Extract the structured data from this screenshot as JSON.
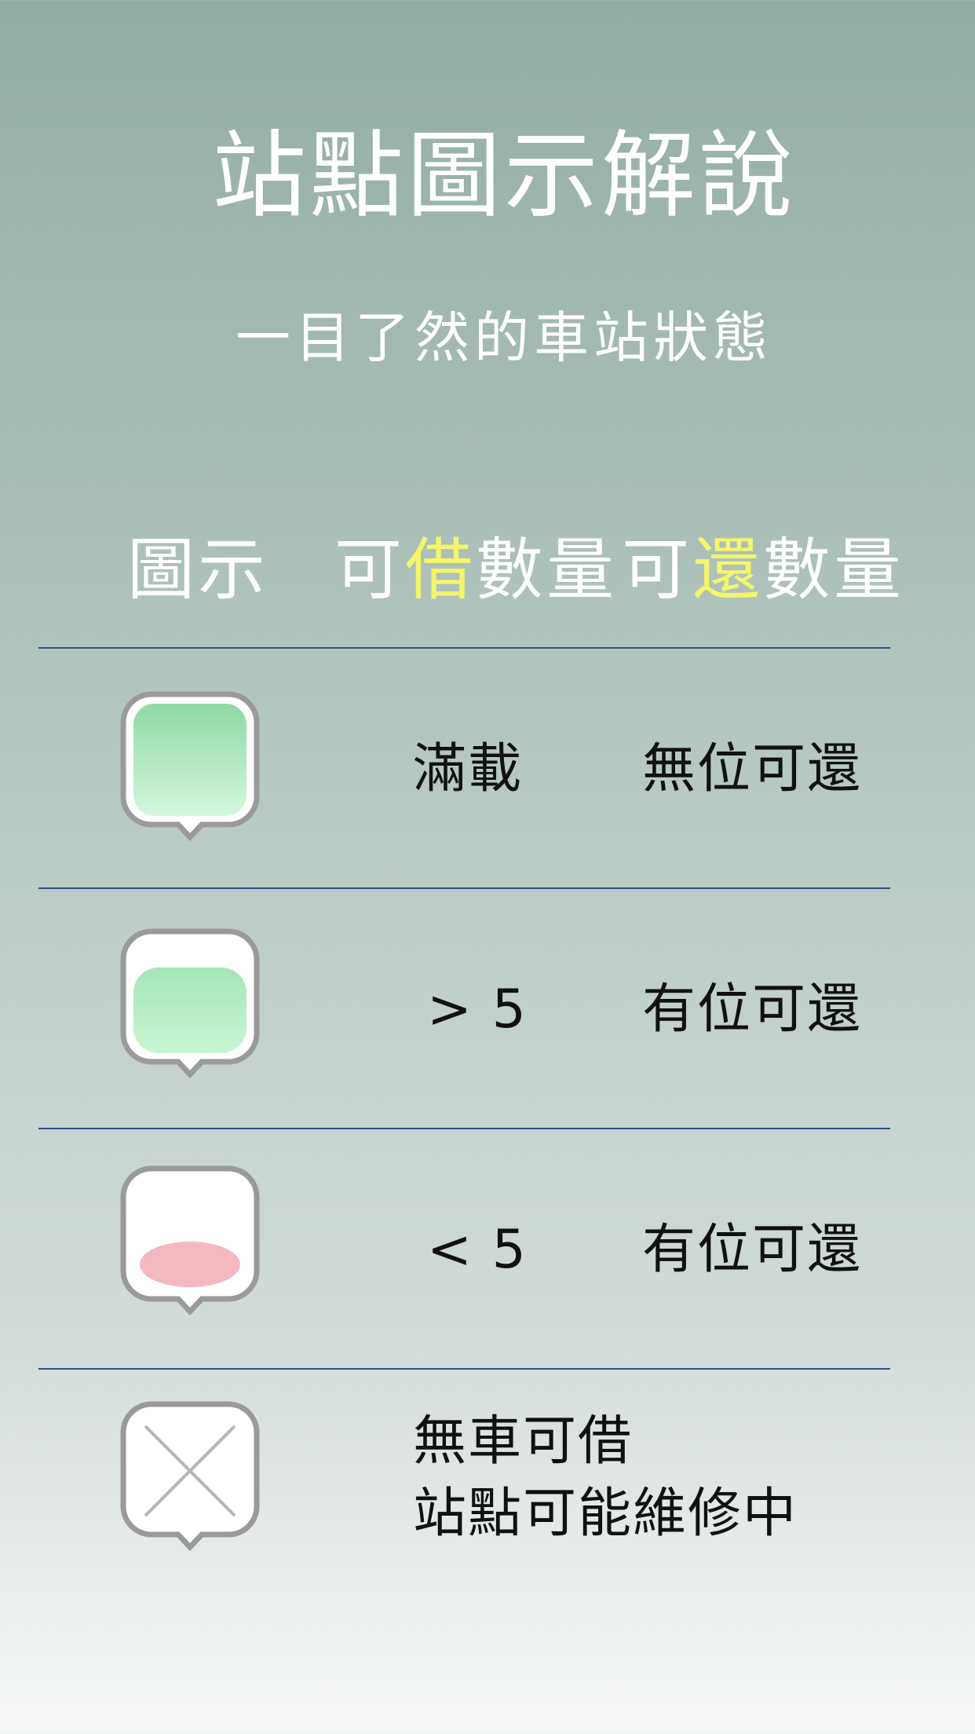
{
  "header": {
    "title": "站點圖示解說",
    "subtitle": "一目了然的車站狀態"
  },
  "columns": {
    "icon": "圖示",
    "borrow_prefix": "可",
    "borrow_highlight": "借",
    "borrow_suffix": "數量",
    "return_prefix": "可",
    "return_highlight": "還",
    "return_suffix": "數量"
  },
  "rows": [
    {
      "icon": "full-station-icon",
      "borrow": "滿載",
      "return": "無位可還"
    },
    {
      "icon": "more-than-five-icon",
      "borrow": "> 5",
      "return": "有位可還"
    },
    {
      "icon": "less-than-five-icon",
      "borrow": "< 5",
      "return": "有位可還"
    },
    {
      "icon": "unavailable-station-icon",
      "status_line1": "無車可借",
      "status_line2": "站點可能維修中"
    }
  ],
  "colors": {
    "highlight": "#f5f56a",
    "divider": "#2e4f86",
    "green_fill_top": "#8fd9a4",
    "green_fill_bottom": "#c6f6d4",
    "pink_fill": "#f3b8c0",
    "icon_border": "#9a9a9a"
  }
}
